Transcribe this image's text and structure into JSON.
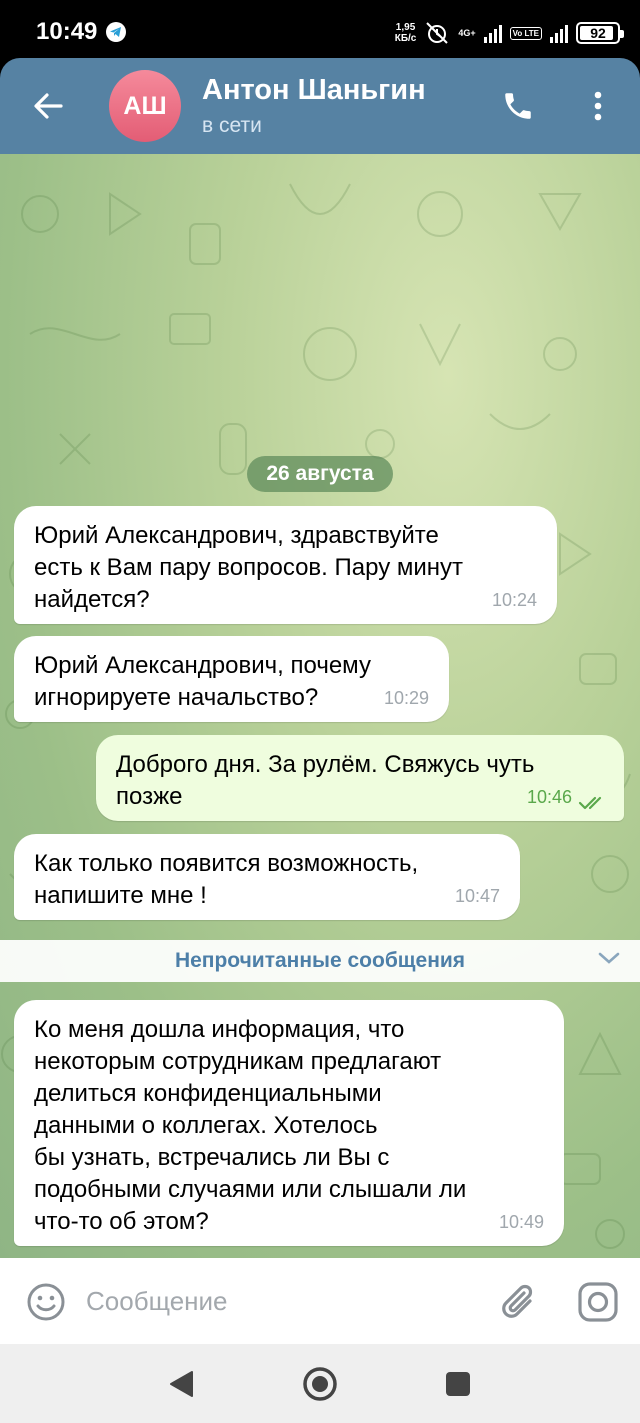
{
  "status_bar": {
    "time": "10:49",
    "speed_value": "1,95",
    "speed_unit": "КБ/с",
    "network": "4G+",
    "volte": "Vo LTE",
    "battery": "92",
    "battery_level": 0.92
  },
  "header": {
    "avatar_initials": "АШ",
    "contact_name": "Антон Шаньгин",
    "contact_status": "в сети"
  },
  "chat": {
    "date_label": "26 августа",
    "messages": [
      {
        "direction": "in",
        "text": "Юрий Александрович, здравствуйте\nесть к Вам пару вопросов. Пару минут\nнайдется?",
        "time": "10:24"
      },
      {
        "direction": "in",
        "text": "Юрий Александрович, почему\nигнорируете начальство?",
        "time": "10:29"
      },
      {
        "direction": "out",
        "text": "Доброго дня. За рулём. Свяжусь чуть\nпозже",
        "time": "10:46",
        "read": true
      },
      {
        "direction": "in",
        "text": "Как только появится возможность,\nнапишите мне !",
        "time": "10:47"
      },
      {
        "direction": "in",
        "text": "Ко меня дошла информация, что\nнекоторым сотрудникам предлагают\nделиться конфиденциальными\nданными о коллегах. Хотелось\nбы узнать, встречались ли Вы с\nподобными случаями или слышали ли\nчто-то об этом?",
        "time": "10:49"
      }
    ],
    "unread_label": "Непрочитанные сообщения"
  },
  "input": {
    "placeholder": "Сообщение",
    "value": ""
  },
  "colors": {
    "header": "#5682a3",
    "outgoing_bubble": "#effdde",
    "incoming_bubble": "#ffffff",
    "accent": "#4d7fa8",
    "read_check": "#5aa84b"
  },
  "icons": {
    "back": "arrow-left-icon",
    "call": "phone-icon",
    "menu": "more-vertical-icon",
    "emoji": "smile-icon",
    "attach": "paperclip-icon",
    "camera": "camera-icon"
  }
}
